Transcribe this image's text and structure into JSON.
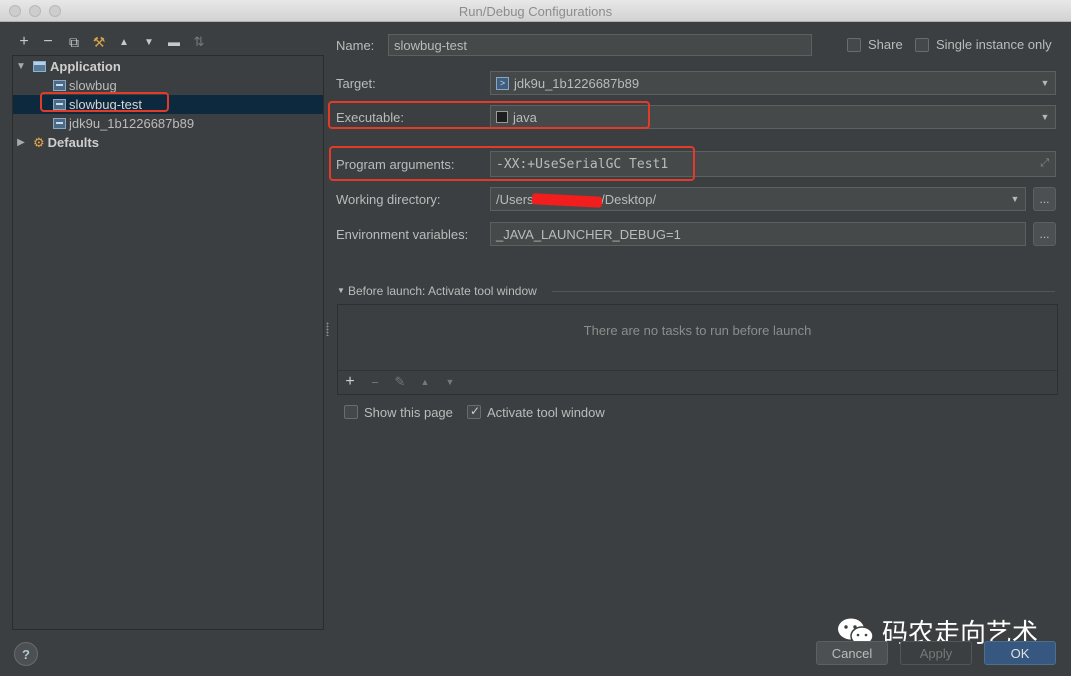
{
  "window": {
    "title": "Run/Debug Configurations"
  },
  "toolbar": {
    "buttons": [
      {
        "name": "add-icon",
        "glyph": "+"
      },
      {
        "name": "remove-icon",
        "glyph": "−"
      },
      {
        "name": "copy-icon",
        "glyph": "⧉"
      },
      {
        "name": "edit-defaults-icon",
        "glyph": "⚒"
      },
      {
        "name": "move-up-icon",
        "glyph": "▲"
      },
      {
        "name": "move-down-icon",
        "glyph": "▼"
      },
      {
        "name": "folder-icon",
        "glyph": "▬"
      },
      {
        "name": "sort-icon",
        "glyph": "⇅"
      }
    ]
  },
  "tree": {
    "application": "Application",
    "items": [
      "slowbug",
      "slowbug-test",
      "jdk9u_1b1226687b89"
    ],
    "selected": "slowbug-test",
    "defaults": "Defaults"
  },
  "form": {
    "name_label": "Name:",
    "name_value": "slowbug-test",
    "share_label": "Share",
    "single_instance_label": "Single instance only",
    "target_label": "Target:",
    "target_value": "jdk9u_1b1226687b89",
    "executable_label": "Executable:",
    "executable_value": "java",
    "program_args_label": "Program arguments:",
    "program_args_value": "-XX:+UseSerialGC Test1",
    "working_dir_label": "Working directory:",
    "working_dir_prefix": "/Users/",
    "working_dir_suffix": "/Desktop/",
    "env_label": "Environment variables:",
    "env_value": "_JAVA_LAUNCHER_DEBUG=1",
    "browse_label": "..."
  },
  "before_launch": {
    "header": "Before launch: Activate tool window",
    "empty_text": "There are no tasks to run before launch",
    "show_page_label": "Show this page",
    "activate_label": "Activate tool window"
  },
  "buttons": {
    "help": "?",
    "cancel": "Cancel",
    "apply": "Apply",
    "ok": "OK"
  },
  "watermark": {
    "text": "码农走向艺术"
  },
  "colors": {
    "accent_ok": "#365880",
    "selection": "#0d293e",
    "highlight_box": "#e23b2a"
  }
}
